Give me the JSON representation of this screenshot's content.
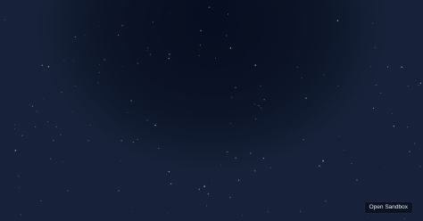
{
  "app": {
    "background_color": "#0f1a2c",
    "star_color": "#b8c6e0"
  },
  "toolbar": {
    "open_sandbox_label": "Open Sandbox"
  }
}
